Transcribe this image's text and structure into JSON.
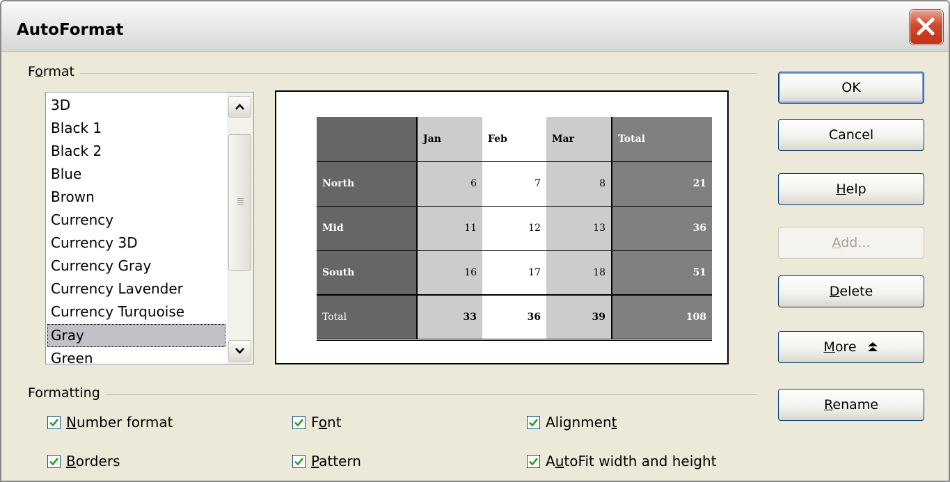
{
  "dialog": {
    "title": "AutoFormat"
  },
  "format_group": {
    "label_pre": "F",
    "label_acc": "o",
    "label_post": "rmat",
    "items": [
      "3D",
      "Black 1",
      "Black 2",
      "Blue",
      "Brown",
      "Currency",
      "Currency 3D",
      "Currency Gray",
      "Currency Lavender",
      "Currency Turquoise",
      "Gray",
      "Green"
    ],
    "selected": "Gray"
  },
  "preview": {
    "columns": [
      "Jan",
      "Feb",
      "Mar",
      "Total"
    ],
    "rows": [
      {
        "label": "North",
        "values": [
          "6",
          "7",
          "8",
          "21"
        ]
      },
      {
        "label": "Mid",
        "values": [
          "11",
          "12",
          "13",
          "36"
        ]
      },
      {
        "label": "South",
        "values": [
          "16",
          "17",
          "18",
          "51"
        ]
      },
      {
        "label": "Total",
        "values": [
          "33",
          "36",
          "39",
          "108"
        ]
      }
    ]
  },
  "buttons": {
    "ok": "OK",
    "cancel": "Cancel",
    "help_acc": "H",
    "help_rest": "elp",
    "add_acc": "A",
    "add_rest": "dd...",
    "delete_acc": "D",
    "delete_rest": "elete",
    "more_acc": "M",
    "more_rest": "ore",
    "rename_acc": "R",
    "rename_rest": "ename"
  },
  "formatting_group": {
    "label": "Formatting",
    "options": {
      "number_format": {
        "pre": "",
        "acc": "N",
        "post": "umber format",
        "checked": true
      },
      "font": {
        "pre": "F",
        "acc": "o",
        "post": "nt",
        "checked": true
      },
      "alignment": {
        "pre": "Alignmen",
        "acc": "t",
        "post": "",
        "checked": true
      },
      "borders": {
        "pre": "",
        "acc": "B",
        "post": "orders",
        "checked": true
      },
      "pattern": {
        "pre": "",
        "acc": "P",
        "post": "attern",
        "checked": true
      },
      "autofit": {
        "pre": "A",
        "acc": "u",
        "post": "toFit width and height",
        "checked": true
      }
    }
  },
  "colors": {
    "check": "#21a121",
    "selected_bg": "#c1c1c7"
  }
}
